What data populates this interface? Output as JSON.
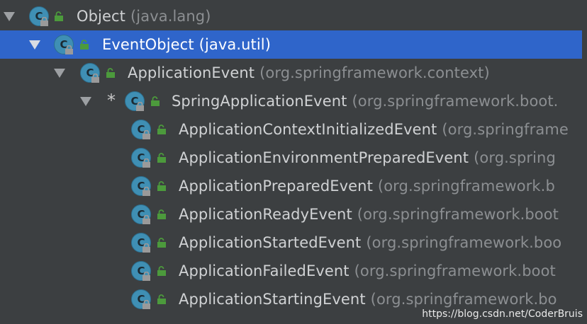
{
  "tree": {
    "rows": [
      {
        "name": "Object",
        "package": "(java.lang)",
        "expanded": true,
        "selected": false
      },
      {
        "name": "EventObject",
        "package": "(java.util)",
        "expanded": true,
        "selected": true
      },
      {
        "name": "ApplicationEvent",
        "package": "(org.springframework.context)",
        "expanded": true,
        "selected": false
      },
      {
        "marker": "*",
        "name": "SpringApplicationEvent",
        "package": "(org.springframework.boot.",
        "expanded": true,
        "selected": false
      },
      {
        "name": "ApplicationContextInitializedEvent",
        "package": "(org.springframe",
        "selected": false
      },
      {
        "name": "ApplicationEnvironmentPreparedEvent",
        "package": "(org.spring",
        "selected": false
      },
      {
        "name": "ApplicationPreparedEvent",
        "package": "(org.springframework.b",
        "selected": false
      },
      {
        "name": "ApplicationReadyEvent",
        "package": "(org.springframework.boot",
        "selected": false
      },
      {
        "name": "ApplicationStartedEvent",
        "package": "(org.springframework.boo",
        "selected": false
      },
      {
        "name": "ApplicationFailedEvent",
        "package": "(org.springframework.boot",
        "selected": false
      },
      {
        "name": "ApplicationStartingEvent",
        "package": "(org.springframework.bo",
        "selected": false
      }
    ]
  },
  "class_icon_letter": "C",
  "colors": {
    "background": "#3c3f41",
    "selection": "#2f65ca",
    "class_icon": "#3f8fb4",
    "public_icon": "#4c9a3c",
    "text": "#d0d2d4",
    "package_text": "#8c8f92"
  },
  "watermark": "https://blog.csdn.net/CoderBruis"
}
